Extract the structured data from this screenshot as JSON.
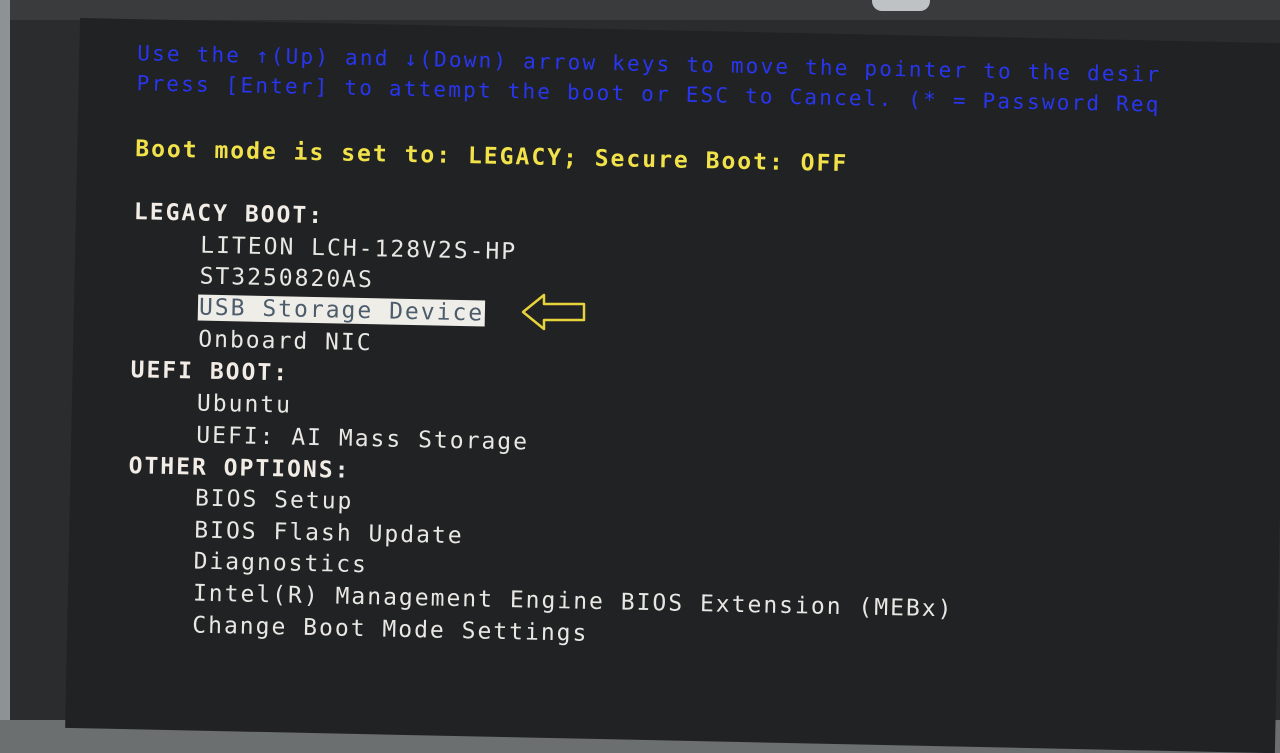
{
  "help": {
    "line1": "Use the ↑(Up) and ↓(Down) arrow keys to move the pointer to the desir",
    "line2": "Press [Enter] to attempt the boot or ESC to Cancel. (* = Password Req"
  },
  "status": "Boot mode is set to: LEGACY; Secure Boot: OFF",
  "sections": {
    "legacy": {
      "heading": "LEGACY BOOT:",
      "items": [
        "LITEON LCH-128V2S-HP",
        "ST3250820AS",
        "USB Storage Device",
        "Onboard NIC"
      ],
      "selected_index": 2
    },
    "uefi": {
      "heading": "UEFI BOOT:",
      "items": [
        "Ubuntu",
        "UEFI: AI Mass Storage"
      ]
    },
    "other": {
      "heading": "OTHER OPTIONS:",
      "items": [
        "BIOS Setup",
        "BIOS Flash Update",
        "Diagnostics",
        "Intel(R) Management Engine BIOS Extension (MEBx)",
        "Change Boot Mode Settings"
      ]
    }
  },
  "colors": {
    "help_text": "#2836f0",
    "status_text": "#f2e24a",
    "menu_text": "#e9e7e3",
    "highlight": "#efede8",
    "arrow_outline": "#e6d23a"
  },
  "icons": {
    "pointer": "left-arrow-icon",
    "bezel_logo": "hp-logo"
  }
}
